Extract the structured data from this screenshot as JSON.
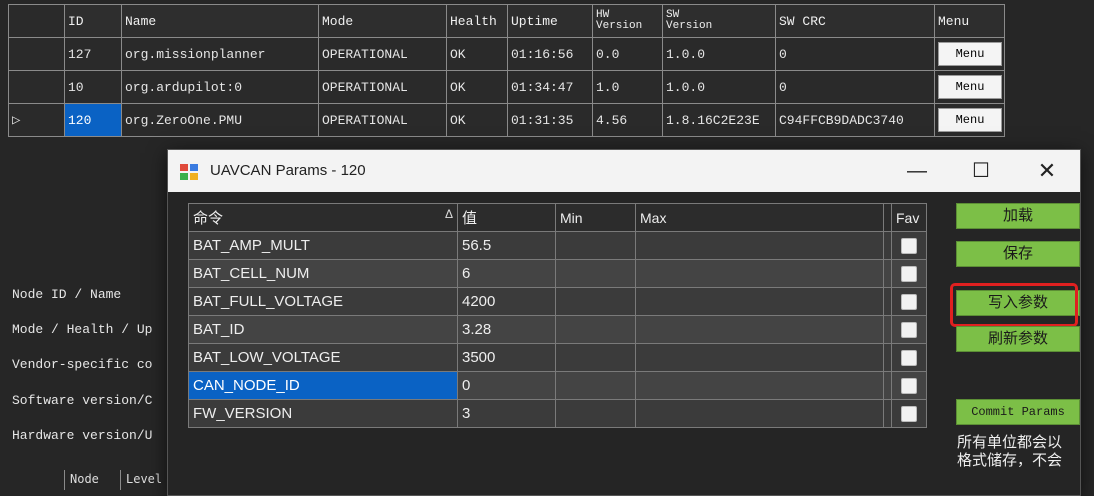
{
  "node_table": {
    "headers": {
      "id": "ID",
      "name": "Name",
      "mode": "Mode",
      "health": "Health",
      "uptime": "Uptime",
      "hw_version_1": "HW",
      "hw_version_2": "Version",
      "sw_version_1": "SW",
      "sw_version_2": "Version",
      "sw_crc": "SW CRC",
      "menu": "Menu"
    },
    "rows": [
      {
        "id": "127",
        "name": "org.missionplanner",
        "mode": "OPERATIONAL",
        "health": "OK",
        "uptime": "01:16:56",
        "hw": "0.0",
        "sw": "1.0.0",
        "crc": "0",
        "menu": "Menu"
      },
      {
        "id": "10",
        "name": "org.ardupilot:0",
        "mode": "OPERATIONAL",
        "health": "OK",
        "uptime": "01:34:47",
        "hw": "1.0",
        "sw": "1.0.0",
        "crc": "0",
        "menu": "Menu"
      },
      {
        "id": "120",
        "name": "org.ZeroOne.PMU",
        "mode": "OPERATIONAL",
        "health": "OK",
        "uptime": "01:31:35",
        "hw": "4.56",
        "sw": "1.8.16C2E23E",
        "crc": "C94FFCB9DADC3740",
        "menu": "Menu"
      }
    ],
    "selected_row_marker": "▷"
  },
  "left_labels": [
    "Node ID / Name",
    "Mode / Health / Up",
    "Vendor-specific co",
    "Software version/C",
    "Hardware version/U"
  ],
  "sub_table_headers": {
    "node": "Node",
    "level": "Level"
  },
  "dialog": {
    "title": "UAVCAN Params - 120",
    "controls": {
      "minimize": "—",
      "maximize": "☐",
      "close": "✕"
    },
    "columns": {
      "command": "命令",
      "sort_indicator": "Δ",
      "value": "值",
      "min": "Min",
      "max": "Max",
      "fav": "Fav"
    },
    "params": [
      {
        "command": "BAT_AMP_MULT",
        "value": "56.5",
        "min": "",
        "max": "",
        "fav": false
      },
      {
        "command": "BAT_CELL_NUM",
        "value": "6",
        "min": "",
        "max": "",
        "fav": false
      },
      {
        "command": "BAT_FULL_VOLTAGE",
        "value": "4200",
        "min": "",
        "max": "",
        "fav": false
      },
      {
        "command": "BAT_ID",
        "value": "3.28",
        "min": "",
        "max": "",
        "fav": false
      },
      {
        "command": "BAT_LOW_VOLTAGE",
        "value": "3500",
        "min": "",
        "max": "",
        "fav": false
      },
      {
        "command": "CAN_NODE_ID",
        "value": "0",
        "min": "",
        "max": "",
        "fav": false
      },
      {
        "command": "FW_VERSION",
        "value": "3",
        "min": "",
        "max": "",
        "fav": false
      }
    ],
    "selected_param": "CAN_NODE_ID",
    "buttons": {
      "load": "加载",
      "save": "保存",
      "write_params": "写入参数",
      "refresh_params": "刷新参数",
      "commit_params": "Commit Params"
    },
    "note_line1": "所有单位都会以",
    "note_line2": "格式储存，不会"
  },
  "colors": {
    "button_green": "#7cbf47",
    "selection_blue": "#0a62c4",
    "highlight_red": "#e02020",
    "background": "#262626"
  }
}
